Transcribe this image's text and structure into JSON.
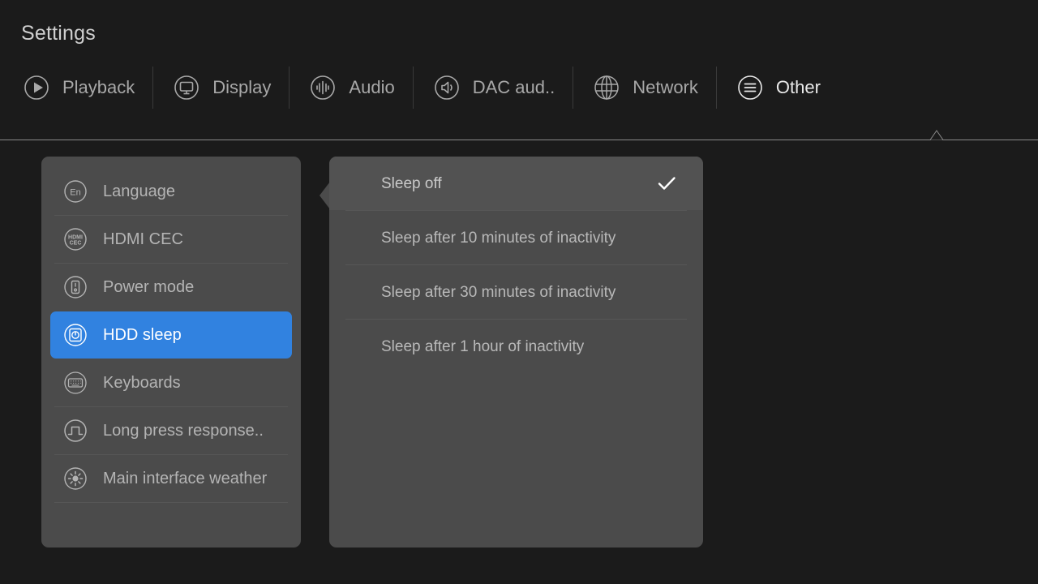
{
  "header": {
    "title": "Settings"
  },
  "tabs": [
    {
      "label": "Playback",
      "icon": "play-circle-icon",
      "active": false
    },
    {
      "label": "Display",
      "icon": "monitor-icon",
      "active": false
    },
    {
      "label": "Audio",
      "icon": "waveform-icon",
      "active": false
    },
    {
      "label": "DAC aud..",
      "icon": "speaker-icon",
      "active": false
    },
    {
      "label": "Network",
      "icon": "globe-icon",
      "active": false
    },
    {
      "label": "Other",
      "icon": "hamburger-menu-icon",
      "active": true
    }
  ],
  "sidebar": {
    "items": [
      {
        "label": "Language",
        "icon": "language-en-icon",
        "selected": false
      },
      {
        "label": "HDMI CEC",
        "icon": "hdmi-cec-icon",
        "selected": false
      },
      {
        "label": "Power mode",
        "icon": "power-mode-icon",
        "selected": false
      },
      {
        "label": "HDD sleep",
        "icon": "hdd-sleep-icon",
        "selected": true
      },
      {
        "label": "Keyboards",
        "icon": "keyboard-icon",
        "selected": false
      },
      {
        "label": "Long press response..",
        "icon": "pulse-wave-icon",
        "selected": false
      },
      {
        "label": "Main interface weather",
        "icon": "weather-sun-icon",
        "selected": false
      }
    ]
  },
  "options": {
    "items": [
      {
        "label": "Sleep off",
        "checked": true,
        "highlight": true
      },
      {
        "label": "Sleep after 10 minutes of inactivity",
        "checked": false,
        "highlight": false
      },
      {
        "label": "Sleep after 30 minutes of inactivity",
        "checked": false,
        "highlight": false
      },
      {
        "label": "Sleep after 1 hour of inactivity",
        "checked": false,
        "highlight": false
      }
    ]
  },
  "colors": {
    "background": "#1b1b1b",
    "panel": "#4b4b4b",
    "panel_highlight": "#525252",
    "accent_blue": "#3182e0",
    "text_dim": "#b4b4b4",
    "text_bright": "#e9e9e9",
    "divider": "#8a8a8a"
  }
}
